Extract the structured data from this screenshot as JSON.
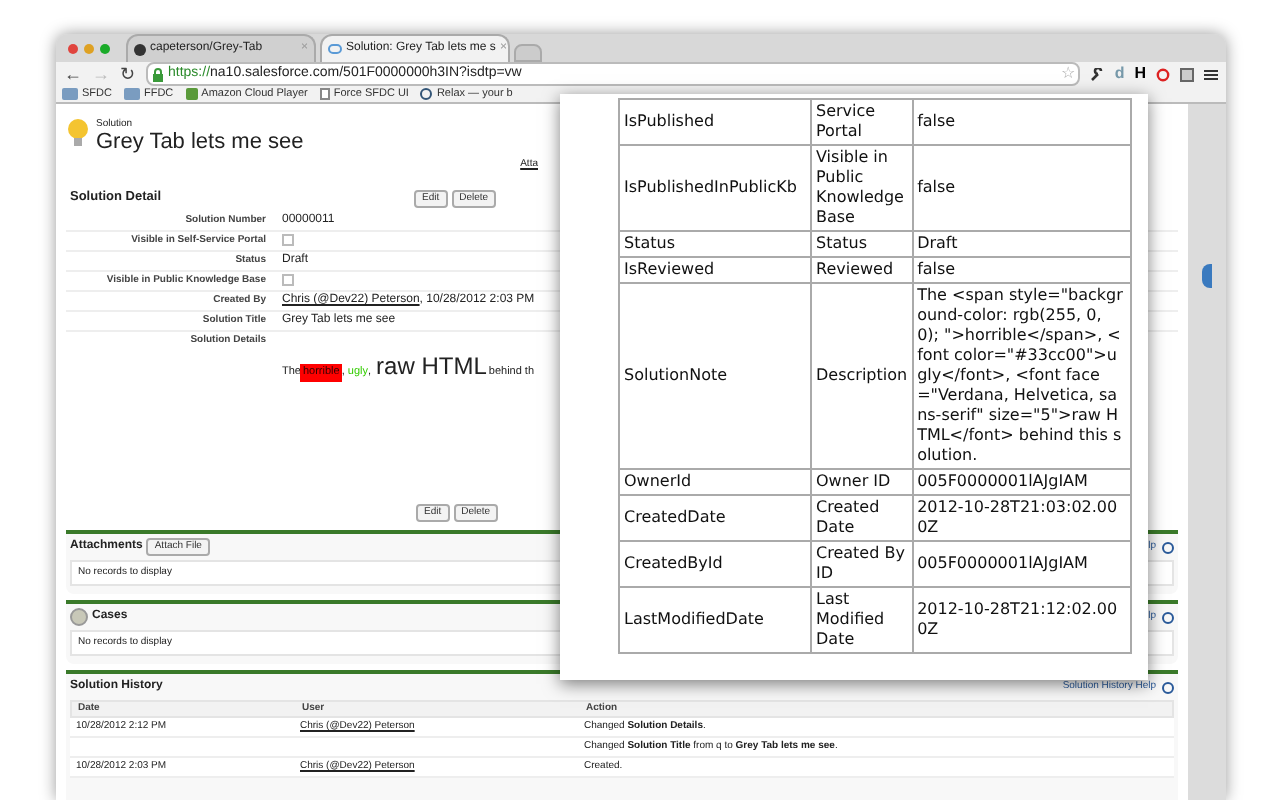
{
  "browser": {
    "tabs": [
      {
        "title": "capeterson/Grey-Tab",
        "kind": "github",
        "selected": false
      },
      {
        "title": "Solution: Grey Tab lets me s",
        "kind": "cloud",
        "selected": true
      }
    ],
    "url_secure": "https://",
    "url_rest": "na10.salesforce.com/501F0000000h3IN?isdtp=vw",
    "extension_letters": [
      "d",
      "H"
    ],
    "nav_glyphs": [
      "←",
      "→",
      "↻"
    ],
    "star": "☆",
    "tab_close": "×",
    "bookmarks": [
      {
        "label": "SFDC",
        "kind": "folder"
      },
      {
        "label": "FFDC",
        "kind": "folder"
      },
      {
        "label": "Amazon Cloud Player",
        "kind": "app"
      },
      {
        "label": "Force SFDC UI",
        "kind": "page"
      },
      {
        "label": "Relax — your b",
        "kind": "site"
      }
    ]
  },
  "page": {
    "object_label": "Solution",
    "title": "Grey Tab lets me see",
    "attach_link": "Atta",
    "detail": {
      "title": "Solution Detail",
      "buttons": [
        "Edit",
        "Delete"
      ],
      "fields": [
        {
          "label": "Solution Number",
          "kind": "text",
          "value": "00000011"
        },
        {
          "label": "Visible in Self-Service Portal",
          "kind": "checkbox",
          "checked": false
        },
        {
          "label": "Status",
          "kind": "text",
          "value": "Draft"
        },
        {
          "label": "Visible in Public Knowledge Base",
          "kind": "checkbox",
          "checked": false
        },
        {
          "label": "Created By",
          "kind": "link",
          "link": "Chris (@Dev22) Peterson",
          "value": ", 10/28/2012 2:03 PM"
        },
        {
          "label": "Solution Title",
          "kind": "text",
          "value": "Grey Tab lets me see"
        },
        {
          "label": "Solution Details",
          "kind": "rich",
          "segments": [
            {
              "text": "The",
              "kind": "plain"
            },
            {
              "text": "horrible",
              "kind": "highlight"
            },
            {
              "text": ", ",
              "kind": "plain"
            },
            {
              "text": "ugly",
              "kind": "green"
            },
            {
              "text": ", ",
              "kind": "plain"
            },
            {
              "text": "raw HTML",
              "kind": "large"
            },
            {
              "text": "behind th",
              "kind": "plain"
            }
          ]
        }
      ],
      "bottom_buttons": [
        "Edit",
        "Delete"
      ]
    },
    "related_lists": [
      {
        "title": "Attachments",
        "kind": "attachments",
        "button": "Attach File",
        "empty": "No records to display",
        "help": "lp"
      },
      {
        "title": "Cases",
        "kind": "cases",
        "empty": "No records to display",
        "help": "lp"
      }
    ],
    "history": {
      "title": "Solution History",
      "help": "Solution History Help",
      "columns": [
        "Date",
        "User",
        "Action"
      ],
      "rows": [
        {
          "date": "10/28/2012 2:12 PM",
          "user": "Chris (@Dev22) Peterson",
          "action": "Changed **Solution Details**."
        },
        {
          "action": "Changed **Solution Title** from q to **Grey Tab lets me see**."
        },
        {
          "date": "10/28/2012 2:03 PM",
          "user": "Chris (@Dev22) Peterson",
          "action": "Created."
        }
      ]
    }
  },
  "popup": {
    "rows": [
      [
        "IsPublished",
        "Service Portal",
        "false"
      ],
      [
        "IsPublishedInPublicKb",
        "Visible in Public Knowledge Base",
        "false"
      ],
      [
        "Status",
        "Status",
        "Draft"
      ],
      [
        "IsReviewed",
        "Reviewed",
        "false"
      ],
      [
        "SolutionNote",
        "Description",
        "The <span style=\"background-color: rgb(255, 0, 0); \">horrible</span>, <font color=\"#33cc00\">ugly</font>, <font face=\"Verdana, Helvetica, sans-serif\" size=\"5\">raw HTML</font> behind this solution."
      ],
      [
        "OwnerId",
        "Owner ID",
        "005F0000001lAJgIAM"
      ],
      [
        "CreatedDate",
        "Created Date",
        "2012-10-28T21:03:02.000Z"
      ],
      [
        "CreatedById",
        "Created By ID",
        "005F0000001lAJgIAM"
      ],
      [
        "LastModifiedDate",
        "Last Modified Date",
        "2012-10-28T21:12:02.000Z"
      ]
    ]
  }
}
